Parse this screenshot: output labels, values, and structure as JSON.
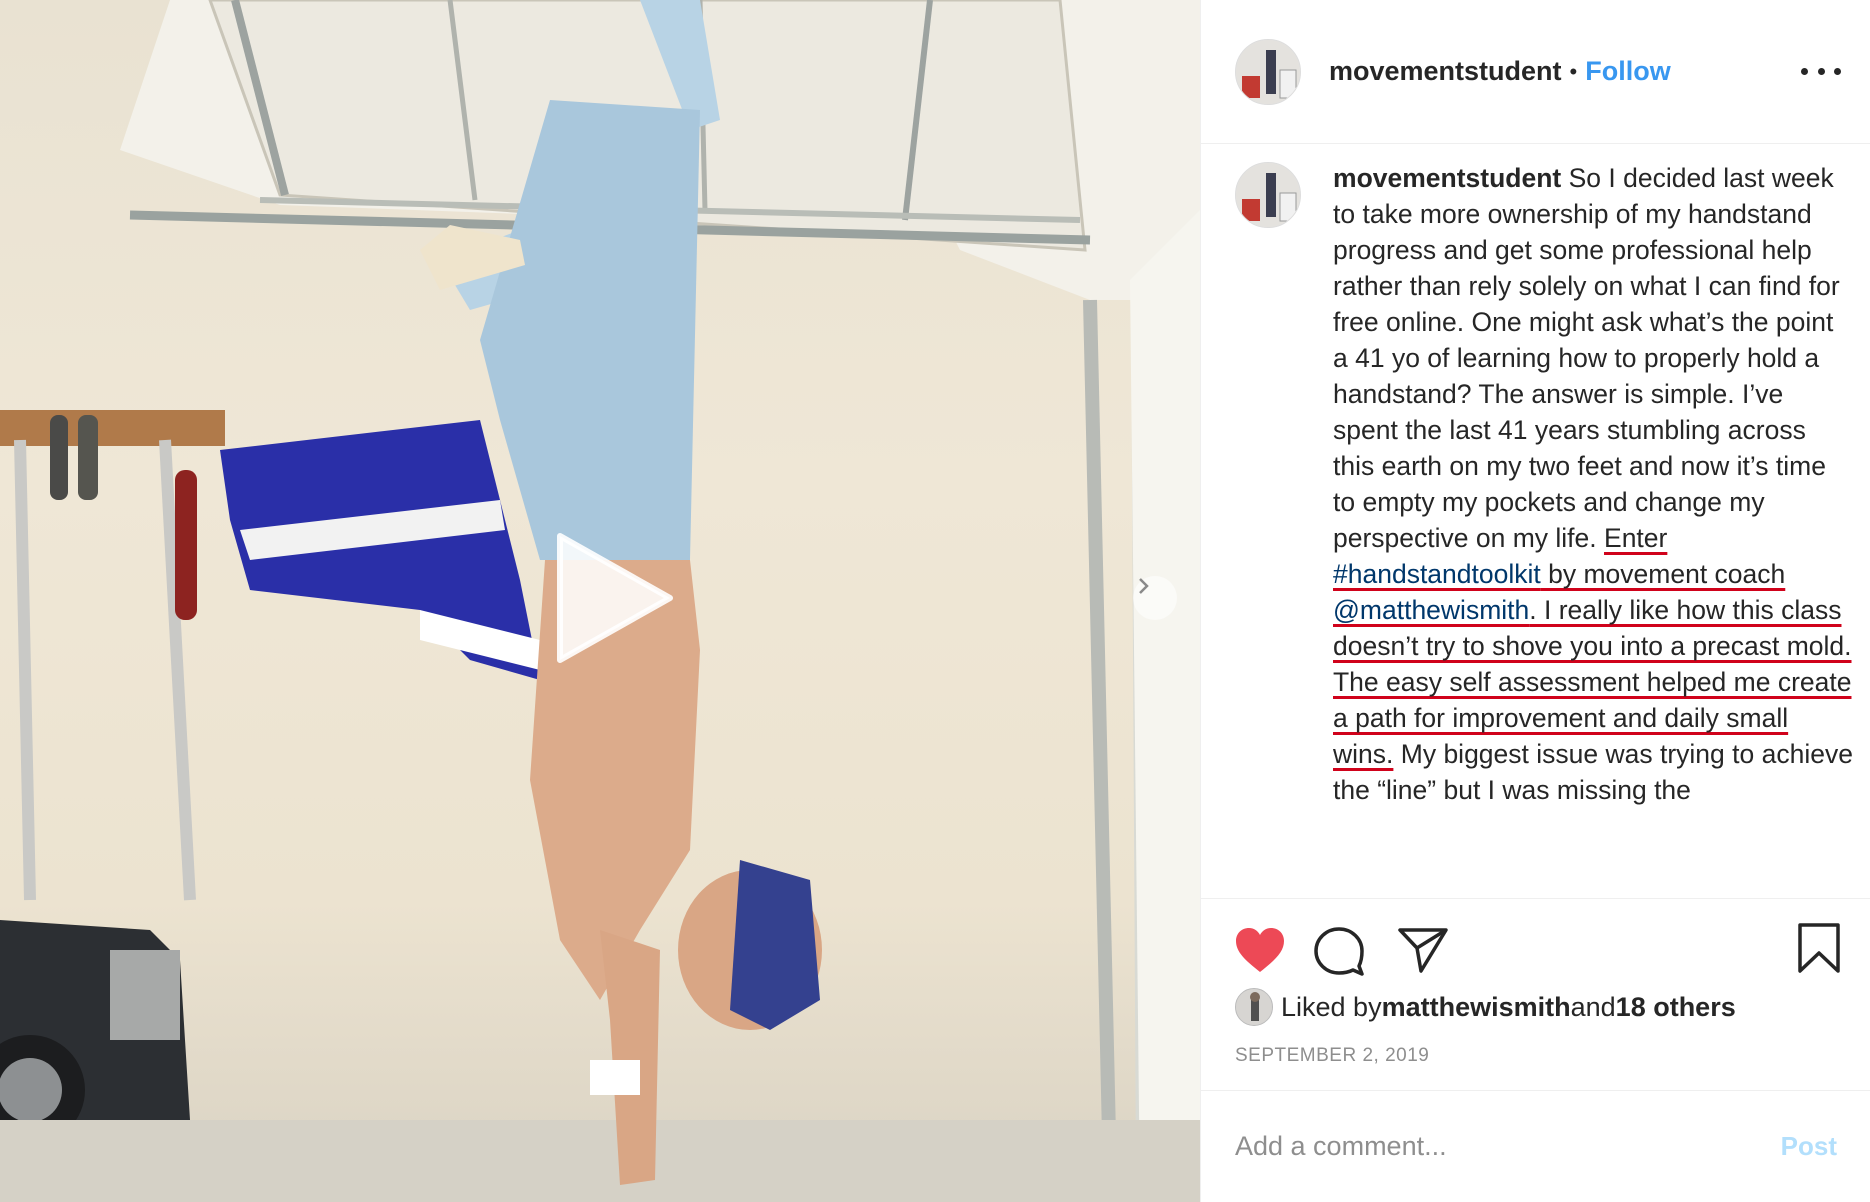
{
  "post": {
    "username": "movementstudent",
    "separator": "•",
    "follow_label": "Follow",
    "more_icon": "more-horizontal-icon"
  },
  "caption": {
    "username": "movementstudent",
    "part1": " So I decided last week to take more ownership of my handstand progress and get some professional help rather than rely solely on what I can find for free online. One might ask what’s the point a 41 yo of learning how to properly hold a handstand? The answer is simple. I’ve spent the last 41 years stumbling across this earth on my two feet and now it’s time to empty my pockets and change my perspective on my life. ",
    "hl_1": "Enter ",
    "hashtag": "#handstandtoolkit",
    "hl_2": " by movement coach ",
    "mention": "@matthewismith",
    "hl_3": ". I really like how this class doesn’t try to shove you into a precast mold. The easy self assessment helped me create a path for improvement and daily small wins.",
    "part2": " My biggest issue was trying to achieve the “line” but I was missing the"
  },
  "actions": {
    "like_icon": "heart-icon",
    "comment_icon": "comment-icon",
    "share_icon": "paper-plane-icon",
    "save_icon": "bookmark-icon",
    "liked_color": "#ed4956"
  },
  "likes": {
    "prefix": "Liked by ",
    "user": "matthewismith",
    "middle": " and ",
    "others": "18 others"
  },
  "date": "SEPTEMBER 2, 2019",
  "comment": {
    "placeholder": "Add a comment...",
    "post_label": "Post"
  },
  "media": {
    "type": "video",
    "play_icon": "play-icon",
    "next_icon": "chevron-right-icon"
  }
}
